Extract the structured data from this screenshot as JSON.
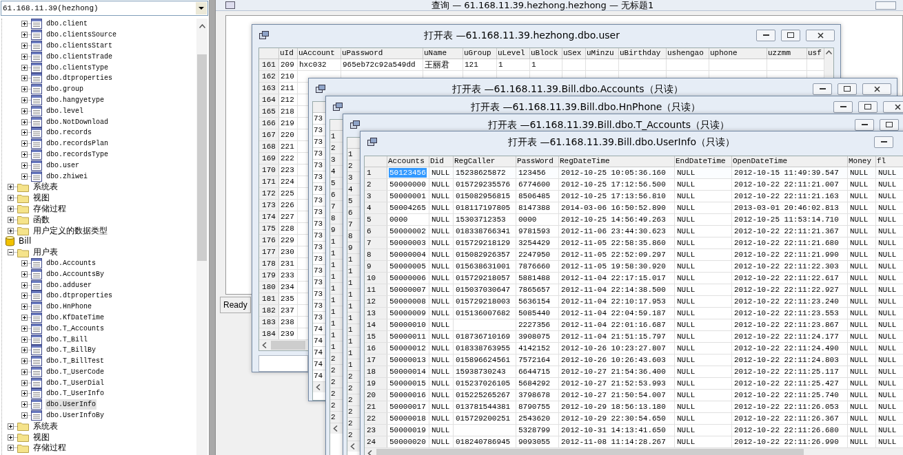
{
  "connection_select": {
    "value": "61.168.11.39(hezhong)"
  },
  "tree": [
    {
      "children": [
        {
          "children": [
            {
              "label": "dbo.client",
              "kind": "table",
              "expanded": false,
              "selected": false
            },
            {
              "label": "dbo.clientsSource",
              "kind": "table",
              "expanded": false,
              "selected": false
            },
            {
              "label": "dbo.clientsStart",
              "kind": "table",
              "expanded": false,
              "selected": false
            },
            {
              "label": "dbo.clientsTrade",
              "kind": "table",
              "expanded": false,
              "selected": false
            },
            {
              "label": "dbo.clientsType",
              "kind": "table",
              "expanded": false,
              "selected": false
            },
            {
              "label": "dbo.dtproperties",
              "kind": "table",
              "expanded": false,
              "selected": false
            },
            {
              "label": "dbo.group",
              "kind": "table",
              "expanded": false,
              "selected": false
            },
            {
              "label": "dbo.hangyetype",
              "kind": "table",
              "expanded": false,
              "selected": false
            },
            {
              "label": "dbo.level",
              "kind": "table",
              "expanded": false,
              "selected": false
            },
            {
              "label": "dbo.NotDownload",
              "kind": "table",
              "expanded": false,
              "selected": false
            },
            {
              "label": "dbo.records",
              "kind": "table",
              "expanded": false,
              "selected": false
            },
            {
              "label": "dbo.recordsPlan",
              "kind": "table",
              "expanded": false,
              "selected": false
            },
            {
              "label": "dbo.recordsType",
              "kind": "table",
              "expanded": false,
              "selected": false
            },
            {
              "label": "dbo.user",
              "kind": "table",
              "expanded": false,
              "selected": false
            },
            {
              "label": "dbo.zhiwei",
              "kind": "table",
              "expanded": false,
              "selected": false
            }
          ]
        },
        {
          "label": "系统表",
          "kind": "folder",
          "expanded": false
        },
        {
          "label": "视图",
          "kind": "folder",
          "expanded": false
        },
        {
          "label": "存储过程",
          "kind": "folder",
          "expanded": false
        },
        {
          "label": "函数",
          "kind": "folder",
          "expanded": false
        },
        {
          "label": "用户定义的数据类型",
          "kind": "folder",
          "expanded": false
        }
      ]
    },
    {
      "label": "Bill",
      "kind": "database",
      "children": [
        {
          "label": "用户表",
          "kind": "folder",
          "expanded": true,
          "children": [
            {
              "label": "dbo.Accounts",
              "kind": "table",
              "expanded": false,
              "selected": false
            },
            {
              "label": "dbo.AccountsBy",
              "kind": "table",
              "expanded": false,
              "selected": false
            },
            {
              "label": "dbo.adduser",
              "kind": "table",
              "expanded": false,
              "selected": false
            },
            {
              "label": "dbo.dtproperties",
              "kind": "table",
              "expanded": false,
              "selected": false
            },
            {
              "label": "dbo.HnPhone",
              "kind": "table",
              "expanded": false,
              "selected": false
            },
            {
              "label": "dbo.KfDateTime",
              "kind": "table",
              "expanded": false,
              "selected": false
            },
            {
              "label": "dbo.T_Accounts",
              "kind": "table",
              "expanded": false,
              "selected": false
            },
            {
              "label": "dbo.T_Bill",
              "kind": "table",
              "expanded": false,
              "selected": false
            },
            {
              "label": "dbo.T_BillBy",
              "kind": "table",
              "expanded": false,
              "selected": false
            },
            {
              "label": "dbo.T_BillTest",
              "kind": "table",
              "expanded": false,
              "selected": false
            },
            {
              "label": "dbo.T_UserCode",
              "kind": "table",
              "expanded": false,
              "selected": false
            },
            {
              "label": "dbo.T_UserDial",
              "kind": "table",
              "expanded": false,
              "selected": false
            },
            {
              "label": "dbo.T_UserInfo",
              "kind": "table",
              "expanded": false,
              "selected": false
            },
            {
              "label": "dbo.UserInfo",
              "kind": "table",
              "expanded": false,
              "selected": true
            },
            {
              "label": "dbo.UserInfoBy",
              "kind": "table",
              "expanded": false,
              "selected": false
            }
          ]
        },
        {
          "label": "系统表",
          "kind": "folder",
          "expanded": false
        },
        {
          "label": "视图",
          "kind": "folder",
          "expanded": false
        },
        {
          "label": "存储过程",
          "kind": "folder",
          "expanded": false
        }
      ]
    }
  ],
  "query_window": {
    "title": "查询 — 61.168.11.39.hezhong.hezhong — 无标题1",
    "status": "Ready"
  },
  "user_window": {
    "title": "打开表 —61.168.11.39.hezhong.dbo.user",
    "columns": [
      "uId",
      "uAccount",
      "uPassword",
      "uName",
      "uGroup",
      "uLevel",
      "uBlock",
      "uSex",
      "uMinzu",
      "uBirthday",
      "ushengao",
      "uphone",
      "uzzmm",
      "usf"
    ],
    "rows": [
      {
        "row_number": "161",
        "cells": [
          "209",
          "hxc032",
          "965eb72c92a549dd",
          "王丽君",
          "121",
          "1",
          "1"
        ]
      },
      {
        "row_number": "162",
        "cells": [
          "210"
        ]
      },
      {
        "row_number": "163",
        "cells": [
          "211"
        ]
      },
      {
        "row_number": "164",
        "cells": [
          "212"
        ]
      },
      {
        "row_number": "165",
        "cells": [
          "218"
        ]
      },
      {
        "row_number": "166",
        "cells": [
          "219"
        ]
      },
      {
        "row_number": "167",
        "cells": [
          "220"
        ]
      },
      {
        "row_number": "168",
        "cells": [
          "221"
        ]
      },
      {
        "row_number": "169",
        "cells": [
          "222"
        ]
      },
      {
        "row_number": "170",
        "cells": [
          "223"
        ]
      },
      {
        "row_number": "171",
        "cells": [
          "224"
        ]
      },
      {
        "row_number": "172",
        "cells": [
          "225"
        ]
      },
      {
        "row_number": "173",
        "cells": [
          "226"
        ]
      },
      {
        "row_number": "174",
        "cells": [
          "227"
        ]
      },
      {
        "row_number": "175",
        "cells": [
          "228"
        ]
      },
      {
        "row_number": "176",
        "cells": [
          "229"
        ]
      },
      {
        "row_number": "177",
        "cells": [
          "230"
        ]
      },
      {
        "row_number": "178",
        "cells": [
          "231"
        ]
      },
      {
        "row_number": "179",
        "cells": [
          "233"
        ]
      },
      {
        "row_number": "180",
        "cells": [
          "234"
        ]
      },
      {
        "row_number": "181",
        "cells": [
          "235"
        ]
      },
      {
        "row_number": "182",
        "cells": [
          "237"
        ]
      },
      {
        "row_number": "183",
        "cells": [
          "238"
        ]
      },
      {
        "row_number": "184",
        "cells": [
          "239"
        ]
      }
    ]
  },
  "accounts_window": {
    "title": "打开表 —61.168.11.39.Bill.dbo.Accounts（只读）",
    "column_values": [
      "73",
      "73",
      "73",
      "73",
      "73",
      "73",
      "73",
      "73",
      "73",
      "73",
      "73",
      "73",
      "73",
      "73",
      "73",
      "73",
      "73",
      "73",
      "74",
      "74",
      "74",
      "74",
      "74"
    ]
  },
  "hnphone_window": {
    "title": "打开表 —61.168.11.39.Bill.dbo.HnPhone（只读）",
    "row_numbers": [
      "1",
      "2",
      "3",
      "4",
      "5",
      "6",
      "7",
      "8",
      "9",
      "1",
      "1",
      "1",
      "1",
      "1",
      "1",
      "1",
      "1",
      "1",
      "1",
      "2",
      "2",
      "2",
      "2",
      "2",
      "2"
    ]
  },
  "t_accounts_window": {
    "title": "打开表 —61.168.11.39.Bill.dbo.T_Accounts（只读）",
    "row_numbers": [
      "1",
      "2",
      "3",
      "4",
      "5",
      "6",
      "7",
      "8",
      "9",
      "1",
      "1",
      "1",
      "1",
      "1",
      "1",
      "1",
      "1",
      "1",
      "1",
      "2",
      "2",
      "2",
      "2",
      "2",
      "2"
    ]
  },
  "userinfo_window": {
    "title": "打开表 —61.168.11.39.Bill.dbo.UserInfo（只读）",
    "columns": [
      "Accounts",
      "Did",
      "RegCaller",
      "PassWord",
      "RegDateTime",
      "EndDateTime",
      "OpenDateTime",
      "Money",
      "fl"
    ],
    "rows": [
      {
        "row_number": "1",
        "selected": true,
        "cells": [
          "50123456",
          "NULL",
          "15238625872",
          "123456",
          "2012-10-25 10:05:36.160",
          "NULL",
          "2012-10-15 11:49:39.547",
          "NULL",
          "NULL"
        ]
      },
      {
        "row_number": "2",
        "selected": false,
        "cells": [
          "50000000",
          "NULL",
          "015729235576",
          "6774600",
          "2012-10-25 17:12:56.500",
          "NULL",
          "2012-10-22 22:11:21.007",
          "NULL",
          "NULL"
        ]
      },
      {
        "row_number": "3",
        "selected": false,
        "cells": [
          "50000001",
          "NULL",
          "015082956815",
          "8506485",
          "2012-10-25 17:13:56.810",
          "NULL",
          "2012-10-22 22:11:21.163",
          "NULL",
          "NULL"
        ]
      },
      {
        "row_number": "4",
        "selected": false,
        "cells": [
          "50004265",
          "NULL",
          "018117197805",
          "8147388",
          "2014-03-06 16:50:52.890",
          "NULL",
          "2013-03-01 20:46:02.813",
          "NULL",
          "NULL"
        ]
      },
      {
        "row_number": "5",
        "selected": false,
        "cells": [
          "0000",
          "NULL",
          "15303712353",
          "0000",
          "2012-10-25 14:56:49.263",
          "NULL",
          "2012-10-25 11:53:14.710",
          "NULL",
          "NULL"
        ]
      },
      {
        "row_number": "6",
        "selected": false,
        "cells": [
          "50000002",
          "NULL",
          "018338766341",
          "9781593",
          "2012-11-06 23:44:30.623",
          "NULL",
          "2012-10-22 22:11:21.367",
          "NULL",
          "NULL"
        ]
      },
      {
        "row_number": "7",
        "selected": false,
        "cells": [
          "50000003",
          "NULL",
          "015729218129",
          "3254429",
          "2012-11-05 22:58:35.860",
          "NULL",
          "2012-10-22 22:11:21.680",
          "NULL",
          "NULL"
        ]
      },
      {
        "row_number": "8",
        "selected": false,
        "cells": [
          "50000004",
          "NULL",
          "015082926357",
          "2247950",
          "2012-11-05 22:52:09.297",
          "NULL",
          "2012-10-22 22:11:21.990",
          "NULL",
          "NULL"
        ]
      },
      {
        "row_number": "9",
        "selected": false,
        "cells": [
          "50000005",
          "NULL",
          "015638631001",
          "7876660",
          "2012-11-05 19:58:30.920",
          "NULL",
          "2012-10-22 22:11:22.303",
          "NULL",
          "NULL"
        ]
      },
      {
        "row_number": "10",
        "selected": false,
        "cells": [
          "50000006",
          "NULL",
          "015729218057",
          "5881488",
          "2012-11-04 22:17:15.017",
          "NULL",
          "2012-10-22 22:11:22.617",
          "NULL",
          "NULL"
        ]
      },
      {
        "row_number": "11",
        "selected": false,
        "cells": [
          "50000007",
          "NULL",
          "015037030647",
          "7865657",
          "2012-11-04 22:14:38.500",
          "NULL",
          "2012-10-22 22:11:22.927",
          "NULL",
          "NULL"
        ]
      },
      {
        "row_number": "12",
        "selected": false,
        "cells": [
          "50000008",
          "NULL",
          "015729218003",
          "5636154",
          "2012-11-04 22:10:17.953",
          "NULL",
          "2012-10-22 22:11:23.240",
          "NULL",
          "NULL"
        ]
      },
      {
        "row_number": "13",
        "selected": false,
        "cells": [
          "50000009",
          "NULL",
          "015136007682",
          "5085440",
          "2012-11-04 22:04:59.187",
          "NULL",
          "2012-10-22 22:11:23.553",
          "NULL",
          "NULL"
        ]
      },
      {
        "row_number": "14",
        "selected": false,
        "cells": [
          "50000010",
          "NULL",
          null,
          "2227356",
          "2012-11-04 22:01:16.687",
          "NULL",
          "2012-10-22 22:11:23.867",
          "NULL",
          "NULL"
        ]
      },
      {
        "row_number": "15",
        "selected": false,
        "cells": [
          "50000011",
          "NULL",
          "018736710169",
          "3908075",
          "2012-11-04 21:51:15.797",
          "NULL",
          "2012-10-22 22:11:24.177",
          "NULL",
          "NULL"
        ]
      },
      {
        "row_number": "16",
        "selected": false,
        "cells": [
          "50000012",
          "NULL",
          "018338763955",
          "4142152",
          "2012-10-26 10:23:27.807",
          "NULL",
          "2012-10-22 22:11:24.490",
          "NULL",
          "NULL"
        ]
      },
      {
        "row_number": "17",
        "selected": false,
        "cells": [
          "50000013",
          "NULL",
          "015896624561",
          "7572164",
          "2012-10-26 10:26:43.603",
          "NULL",
          "2012-10-22 22:11:24.803",
          "NULL",
          "NULL"
        ]
      },
      {
        "row_number": "18",
        "selected": false,
        "cells": [
          "50000014",
          "NULL",
          "15938730243",
          "6644715",
          "2012-10-27 21:54:36.400",
          "NULL",
          "2012-10-22 22:11:25.117",
          "NULL",
          "NULL"
        ]
      },
      {
        "row_number": "19",
        "selected": false,
        "cells": [
          "50000015",
          "NULL",
          "015237026105",
          "5684292",
          "2012-10-27 21:52:53.993",
          "NULL",
          "2012-10-22 22:11:25.427",
          "NULL",
          "NULL"
        ]
      },
      {
        "row_number": "20",
        "selected": false,
        "cells": [
          "50000016",
          "NULL",
          "015225265267",
          "3798678",
          "2012-10-27 21:50:54.007",
          "NULL",
          "2012-10-22 22:11:25.740",
          "NULL",
          "NULL"
        ]
      },
      {
        "row_number": "21",
        "selected": false,
        "cells": [
          "50000017",
          "NULL",
          "013781544381",
          "8790755",
          "2012-10-29 18:56:13.180",
          "NULL",
          "2012-10-22 22:11:26.053",
          "NULL",
          "NULL"
        ]
      },
      {
        "row_number": "22",
        "selected": false,
        "cells": [
          "50000018",
          "NULL",
          "015729200251",
          "2543620",
          "2012-10-29 22:30:54.650",
          "NULL",
          "2012-10-22 22:11:26.367",
          "NULL",
          "NULL"
        ]
      },
      {
        "row_number": "23",
        "selected": false,
        "cells": [
          "50000019",
          "NULL",
          null,
          "5328799",
          "2012-10-31 14:13:41.650",
          "NULL",
          "2012-10-22 22:11:26.680",
          "NULL",
          "NULL"
        ]
      },
      {
        "row_number": "24",
        "selected": false,
        "cells": [
          "50000020",
          "NULL",
          "018240786945",
          "9093055",
          "2012-11-08 11:14:28.267",
          "NULL",
          "2012-10-22 22:11:26.990",
          "NULL",
          "NULL"
        ]
      }
    ]
  }
}
